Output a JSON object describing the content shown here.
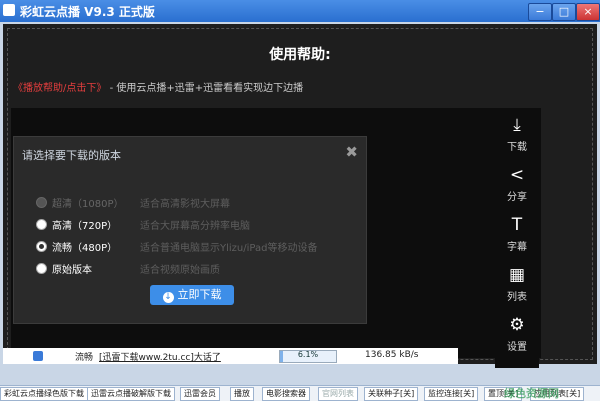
{
  "window": {
    "title": "彩虹云点播 V9.3 正式版",
    "buttons": {
      "minimize": "−",
      "maximize": "□",
      "close": "×"
    }
  },
  "help": {
    "title": "使用帮助:",
    "link_text": "《播放帮助/点击下》",
    "line_text": "- 使用云点播+迅雷+迅雷看看实现边下边播"
  },
  "dialog": {
    "title": "请选择要下载的版本",
    "close": "✖",
    "options": [
      {
        "label": "超清（1080P）",
        "desc": "适合高清影视大屏幕",
        "state": "disabled"
      },
      {
        "label": "高清（720P）",
        "desc": "适合大屏幕高分辨率电脑",
        "state": "normal"
      },
      {
        "label": "流畅（480P）",
        "desc": "适合普通电脑显示Ylizu/iPad等移动设备",
        "state": "selected"
      },
      {
        "label": "原始版本",
        "desc": "适合视频原始画质",
        "state": "normal"
      }
    ],
    "download_label": "立即下载",
    "download_icon": "↓"
  },
  "sidebar": [
    {
      "icon": "⤓",
      "icon_name": "download-icon",
      "label": "下载"
    },
    {
      "icon": "<",
      "icon_name": "share-icon",
      "label": "分享"
    },
    {
      "icon": "T",
      "icon_name": "subtitle-icon",
      "label": "字幕"
    },
    {
      "icon": "▦",
      "icon_name": "list-icon",
      "label": "列表"
    },
    {
      "icon": "⚙",
      "icon_name": "gear-icon",
      "label": "设置"
    }
  ],
  "task": {
    "status": "流畅",
    "name": "[迅雷下载www.2tu.cc]大话了",
    "progress_text": "6.1%",
    "progress": 0.061,
    "speed": "136.85 kB/s"
  },
  "bottombar": {
    "items": [
      "彩虹云点播绿色版下载",
      "迅雷云点播破解版下载",
      "迅雷会员",
      "播放",
      "电影搜索器",
      "官网列表",
      "关联种子[关]",
      "监控连接[关]",
      "置顶[关]",
      "应用列表[关]"
    ]
  },
  "watermark": {
    "text": "绿色资源网"
  },
  "colors": {
    "accent": "#3d8ee8",
    "title_gradient_top": "#4a8ee6",
    "link_red": "#e53e3e"
  }
}
